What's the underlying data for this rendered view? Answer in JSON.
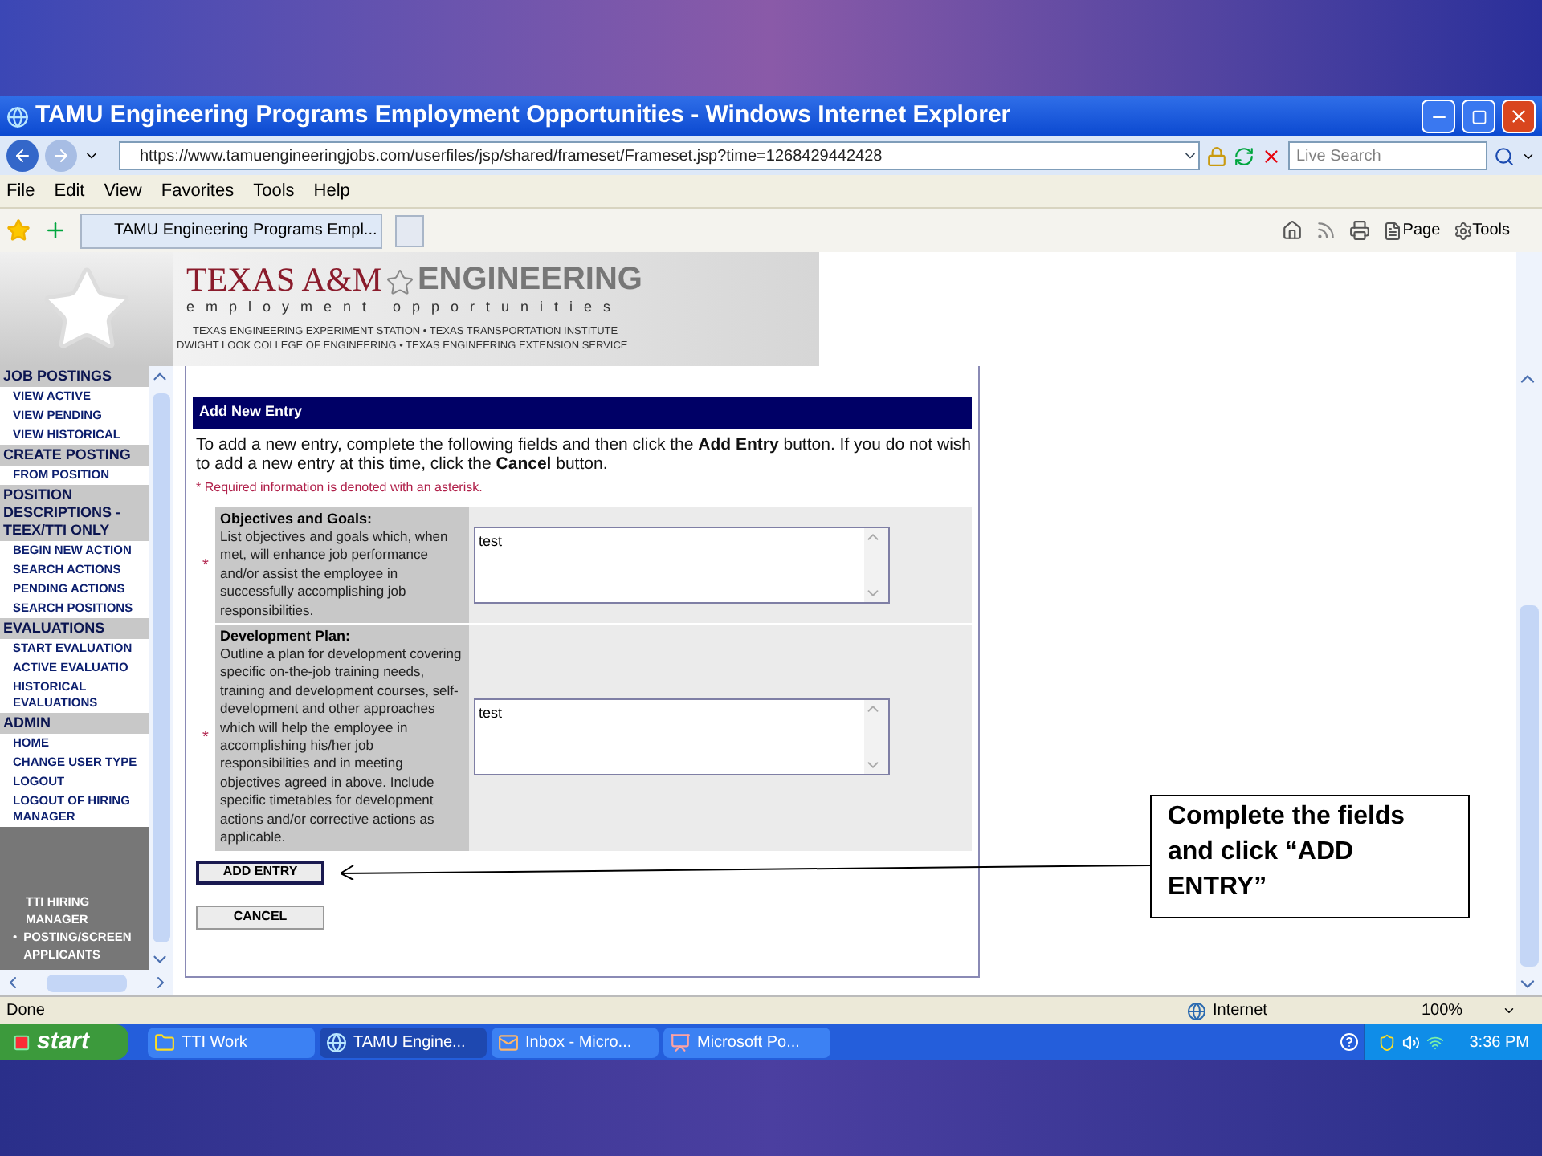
{
  "window": {
    "title": "TAMU Engineering Programs Employment Opportunities - Windows Internet Explorer"
  },
  "address": {
    "url": "https://www.tamuengineeringjobs.com/userfiles/jsp/shared/frameset/Frameset.jsp?time=1268429442428",
    "search_placeholder": "Live Search"
  },
  "menu": [
    "File",
    "Edit",
    "View",
    "Favorites",
    "Tools",
    "Help"
  ],
  "tabs": [
    {
      "label": "TAMU Engineering Programs Empl...",
      "selected": true
    }
  ],
  "toolbar": [
    "Page",
    "Tools"
  ],
  "header": {
    "brand": "TEXAS A&M",
    "brand2": "ENGINEERING",
    "tagline": "employment opportunities",
    "line1": "TEXAS ENGINEERING EXPERIMENT STATION • TEXAS TRANSPORTATION INSTITUTE",
    "line2": "DWIGHT LOOK COLLEGE OF ENGINEERING • TEXAS ENGINEERING EXTENSION SERVICE"
  },
  "sidebar": {
    "sections": [
      {
        "title": "JOB POSTINGS",
        "items": [
          "VIEW ACTIVE",
          "VIEW PENDING",
          "VIEW HISTORICAL"
        ]
      },
      {
        "title": "CREATE POSTING",
        "items": [
          "FROM POSITION"
        ]
      },
      {
        "title": "POSITION DESCRIPTIONS - TEEX/TTI ONLY",
        "items": [
          "BEGIN NEW ACTION",
          "SEARCH ACTIONS",
          "PENDING ACTIONS",
          "SEARCH POSITIONS"
        ]
      },
      {
        "title": "EVALUATIONS",
        "items": [
          "START EVALUATION",
          "ACTIVE EVALUATIO",
          "HISTORICAL EVALUATIONS"
        ]
      },
      {
        "title": "ADMIN",
        "items": [
          "HOME",
          "CHANGE USER TYPE",
          "LOGOUT",
          "LOGOUT OF HIRING MANAGER"
        ]
      }
    ],
    "role": {
      "title": "TTI HIRING MANAGER",
      "items": [
        {
          "bullet": "•",
          "label": "POSTING/SCREEN APPLICANTS"
        }
      ]
    }
  },
  "form": {
    "title": "Add New Entry",
    "intro": "To add a new entry, complete the following fields and then click the **Add Entry** button. If you do not wish to add a new entry at this time, click the **Cancel** button.",
    "required_note": "* Required information is denoted with an asterisk.",
    "fields": [
      {
        "mark": "*",
        "label": "Objectives and Goals:",
        "description": "List objectives and goals which, when met, will enhance job performance and/or assist the employee in successfully accomplishing job responsibilities.",
        "value": "test"
      },
      {
        "mark": "*",
        "label": "Development Plan:",
        "description": "Outline a plan for development covering specific on-the-job training needs, training and development courses, self-development and other approaches which will help the employee in accomplishing his/her job responsibilities and in meeting objectives agreed in above. Include specific timetables for development actions and/or corrective actions as applicable.",
        "value": "test"
      }
    ],
    "buttons": [
      {
        "label": "ADD ENTRY",
        "focused": true
      },
      {
        "label": "CANCEL",
        "focused": false
      }
    ]
  },
  "callout": {
    "text": "Complete the fields and click “ADD ENTRY”"
  },
  "status_bar": {
    "text": "Done",
    "zone": "Internet",
    "zoom": "100%"
  },
  "taskbar": {
    "start": "start",
    "tasks": [
      {
        "kind": "folder",
        "label": "TTI Work",
        "selected": false
      },
      {
        "kind": "browser",
        "label": "TAMU Engine...",
        "selected": true
      },
      {
        "kind": "mail",
        "label": "Inbox - Micro...",
        "selected": false
      },
      {
        "kind": "slides",
        "label": "Microsoft Po...",
        "selected": false
      }
    ],
    "clock": "3:36 PM"
  }
}
